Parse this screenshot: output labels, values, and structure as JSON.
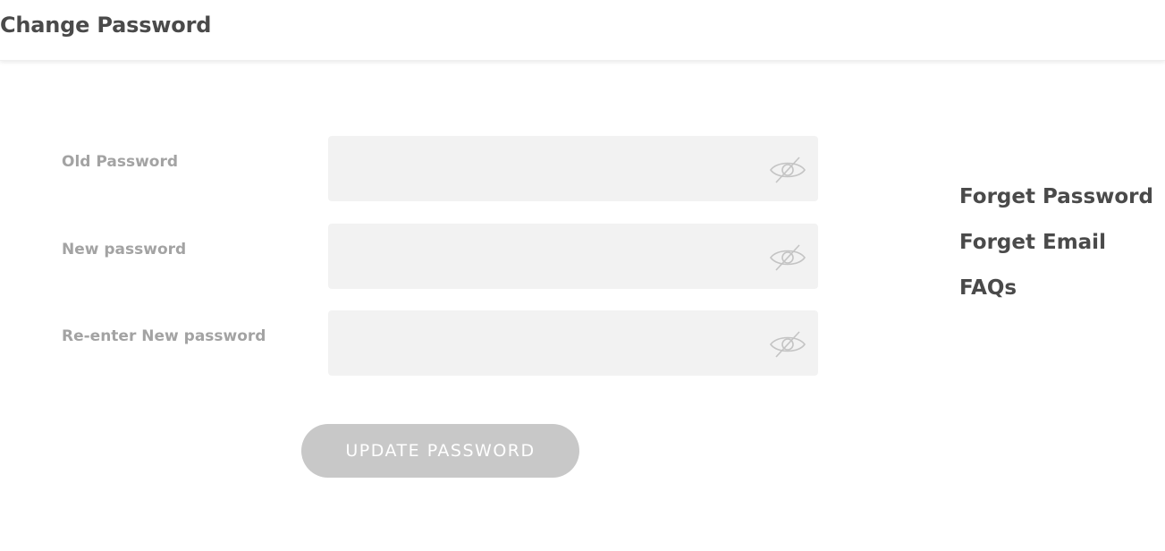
{
  "header": {
    "title": "Change Password"
  },
  "form": {
    "fields": [
      {
        "label": "Old Password",
        "value": "",
        "icon": "eye-slash-icon"
      },
      {
        "label": "New password",
        "value": "",
        "icon": "eye-slash-icon"
      },
      {
        "label": "Re-enter New password",
        "value": "",
        "icon": "eye-slash-icon"
      }
    ],
    "submit_label": "UPDATE PASSWORD"
  },
  "sidebar": {
    "links": [
      {
        "label": "Forget Password"
      },
      {
        "label": "Forget Email"
      },
      {
        "label": "FAQs"
      }
    ]
  },
  "colors": {
    "title_text": "#4a4a4a",
    "label_text": "#a3a3a3",
    "input_bg": "#f2f2f2",
    "button_bg": "#c8c8c8",
    "button_text": "#ffffff",
    "icon_stroke": "#c4c4c4"
  }
}
